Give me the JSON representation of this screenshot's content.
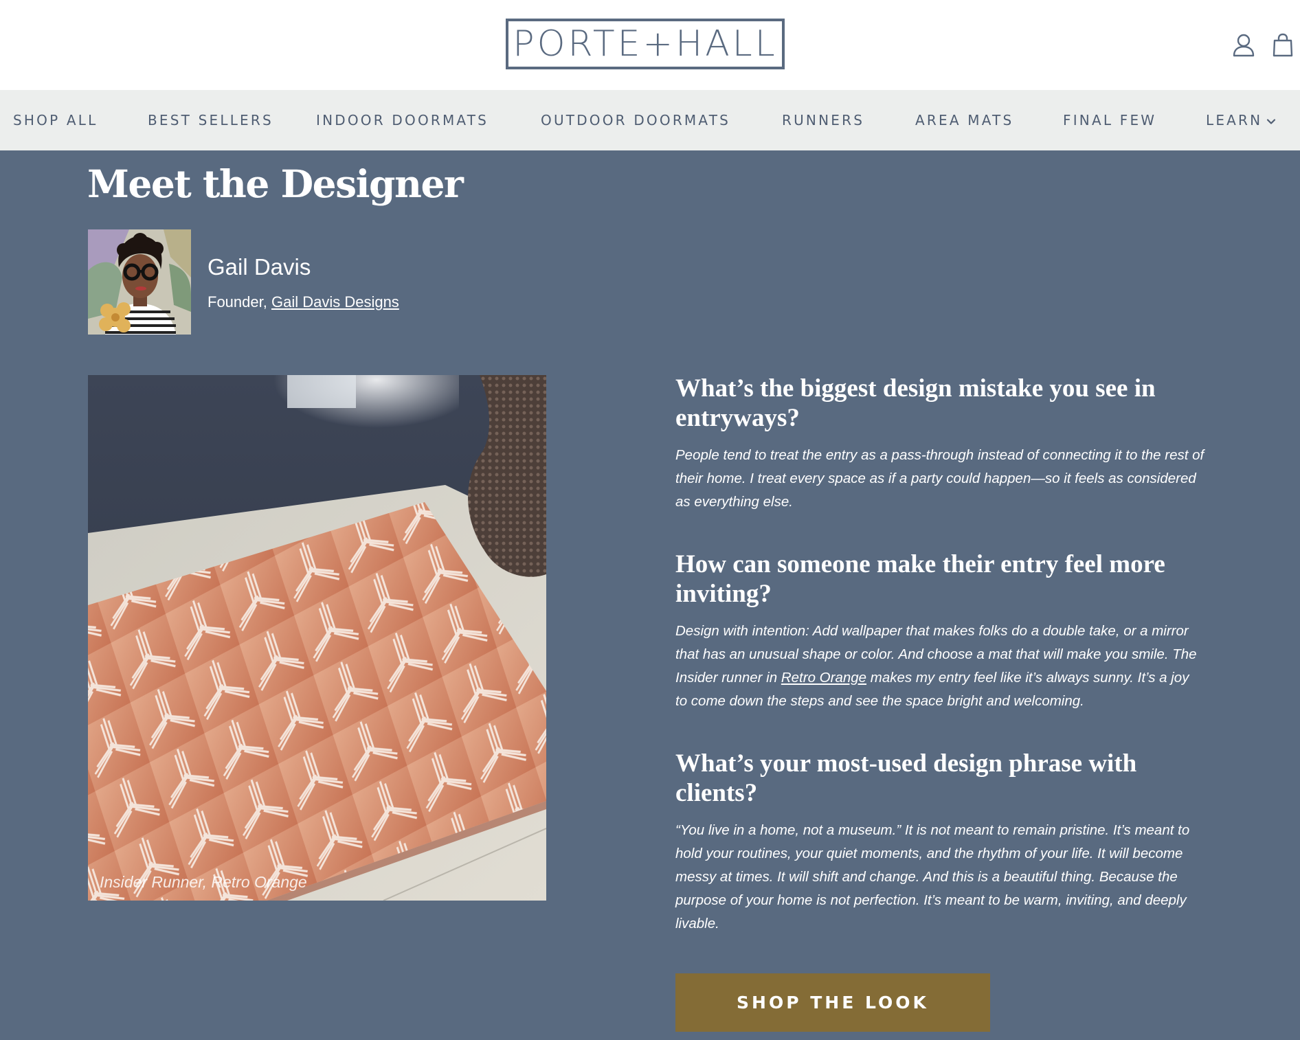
{
  "header": {
    "logo_text": "PORTE+HALL",
    "account_icon": "person-outline-icon",
    "cart_icon": "shopping-bag-icon"
  },
  "nav": {
    "items": [
      {
        "label": "SHOP ALL"
      },
      {
        "label": "BEST SELLERS"
      },
      {
        "label": "INDOOR DOORMATS"
      },
      {
        "label": "OUTDOOR DOORMATS"
      },
      {
        "label": "RUNNERS"
      },
      {
        "label": "AREA MATS"
      },
      {
        "label": "FINAL FEW"
      },
      {
        "label": "LEARN",
        "icon": "chevron-down-icon"
      }
    ]
  },
  "designer": {
    "section_title": "Meet the Designer",
    "name": "Gail Davis",
    "role_prefix": "Founder,",
    "company_link": "Gail Davis Designs"
  },
  "photo": {
    "caption": "Insider Runner, Retro Orange"
  },
  "qa": [
    {
      "question": "What’s the biggest design mistake you see in entryways?",
      "answer": "People tend to treat the entry as a pass-through instead of connecting it to the rest of their home. I treat every space as if a party could happen—so it feels as considered as everything else."
    },
    {
      "question": "How can someone make their entry feel more inviting?",
      "answer_before_link": "Design with intention: Add wallpaper that makes folks do a double take, or a mirror that has an unusual shape or color. And choose a mat that will make you smile. The Insider runner in ",
      "answer_link": "Retro Orange",
      "answer_after_link": " makes my entry feel like it’s always sunny. It’s a joy to come down the steps and see the space bright and welcoming."
    },
    {
      "question": "What’s your most-used design phrase with clients?",
      "answer": "“You live in a home, not a museum.” It is not meant to remain pristine. It’s meant to hold your routines, your quiet moments, and the rhythm of your life. It will become messy at times. It will shift and change. And this is a beautiful thing. Because the purpose of your home is not perfection. It’s meant to be warm, inviting, and deeply livable."
    }
  ],
  "cta": {
    "label": "SHOP THE LOOK"
  },
  "colors": {
    "page_background": "#596a80",
    "nav_background": "#eceeed",
    "brand_slate": "#5a6a80",
    "cta_gold": "#846c36"
  }
}
